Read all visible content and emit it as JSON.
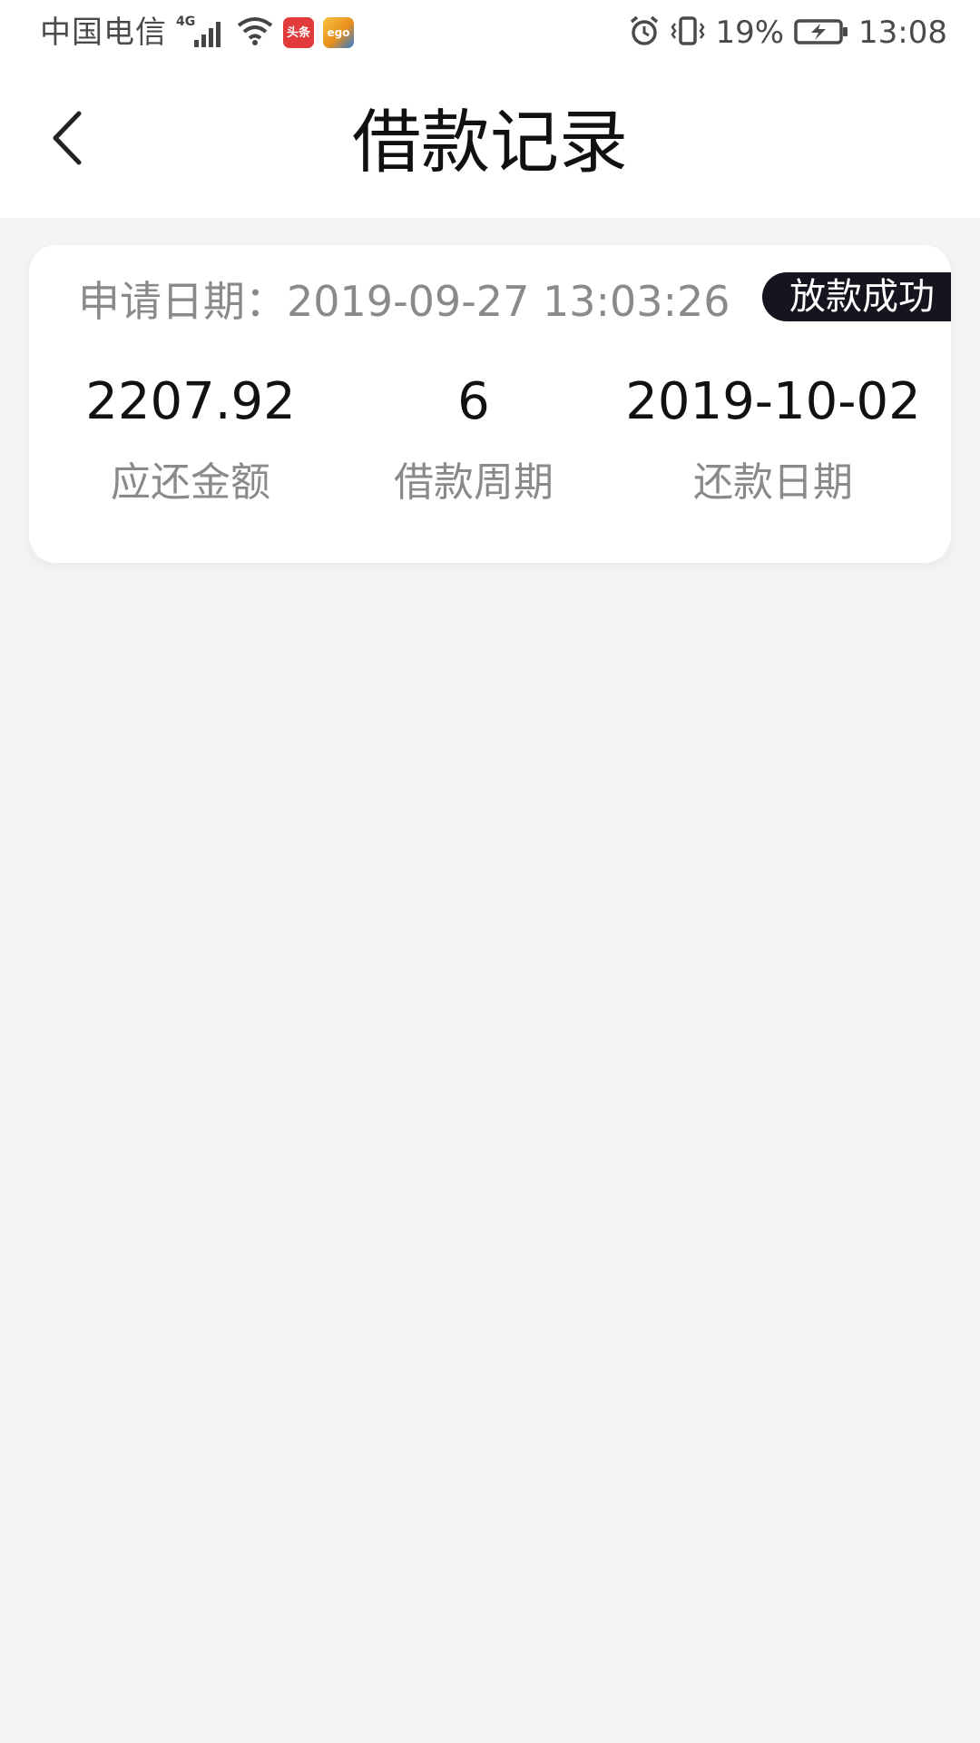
{
  "status_bar": {
    "carrier": "中国电信",
    "network": "4G",
    "app_badges": [
      {
        "name": "toutiao",
        "text": "头条"
      },
      {
        "name": "ego",
        "text": "ego"
      }
    ],
    "battery_percent": "19%",
    "time": "13:08",
    "icons": [
      "signal-icon",
      "wifi-icon",
      "alarm-icon",
      "vibrate-icon",
      "battery-charging-icon"
    ]
  },
  "header": {
    "title": "借款记录",
    "back_icon": "chevron-left-icon"
  },
  "records": [
    {
      "apply_label": "申请日期：",
      "apply_date": "2019-09-27 13:03:26",
      "status": "放款成功",
      "amount_due": "2207.92",
      "amount_due_label": "应还金额",
      "period": "6",
      "period_label": "借款周期",
      "repay_date": "2019-10-02",
      "repay_date_label": "还款日期"
    }
  ],
  "colors": {
    "page_background": "#f4f4f4",
    "card_background": "#ffffff",
    "badge_background": "#15151f",
    "secondary_text": "#8a8a8a"
  }
}
